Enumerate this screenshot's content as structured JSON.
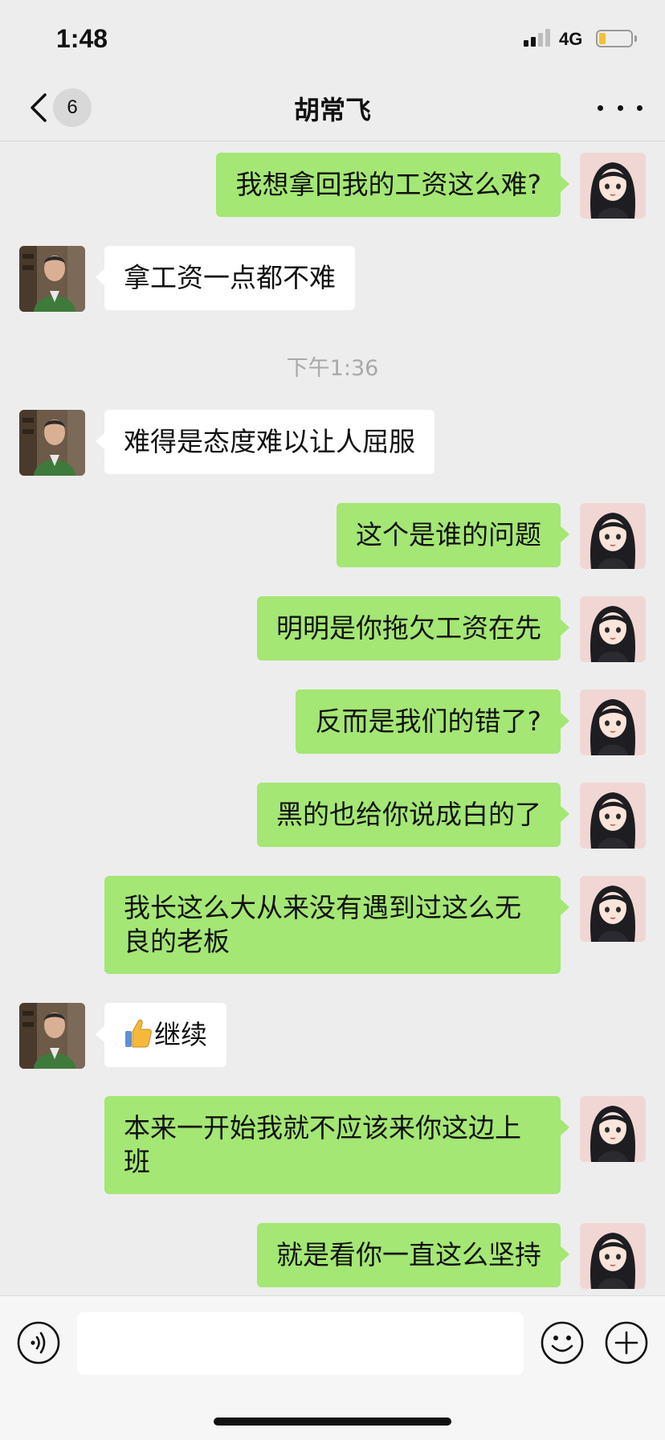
{
  "status_bar": {
    "time": "1:48",
    "network": "4G",
    "battery_color": "#f2c230"
  },
  "nav": {
    "unread_count": "6",
    "title": "胡常飞",
    "icons": [
      "chevron-left-icon",
      "more-icon"
    ]
  },
  "messages": [
    {
      "side": "right",
      "text": "我想拿回我的工资这么难?"
    },
    {
      "side": "left",
      "text": "拿工资一点都不难"
    },
    {
      "side": "left",
      "text": "难得是态度难以让人屈服"
    },
    {
      "side": "right",
      "text": "这个是谁的问题"
    },
    {
      "side": "right",
      "text": "明明是你拖欠工资在先"
    },
    {
      "side": "right",
      "text": "反而是我们的错了?"
    },
    {
      "side": "right",
      "text": "黑的也给你说成白的了"
    },
    {
      "side": "right",
      "text": "我长这么大从来没有遇到过这么无",
      "text2": "良的老板"
    },
    {
      "side": "left",
      "text": "继续",
      "emoji": "thumbs-up-icon"
    },
    {
      "side": "right",
      "text": "本来一开始我就不应该来你这边上",
      "text2": "班"
    },
    {
      "side": "right",
      "text": "就是看你一直这么坚持"
    }
  ],
  "time_separator": "下午1:36",
  "input_bar": {
    "value": "",
    "icons": [
      "voice-icon",
      "emoji-icon",
      "plus-icon"
    ]
  },
  "colors": {
    "sent_bubble": "#a4e774",
    "received_bubble": "#ffffff",
    "background": "#ededed"
  }
}
